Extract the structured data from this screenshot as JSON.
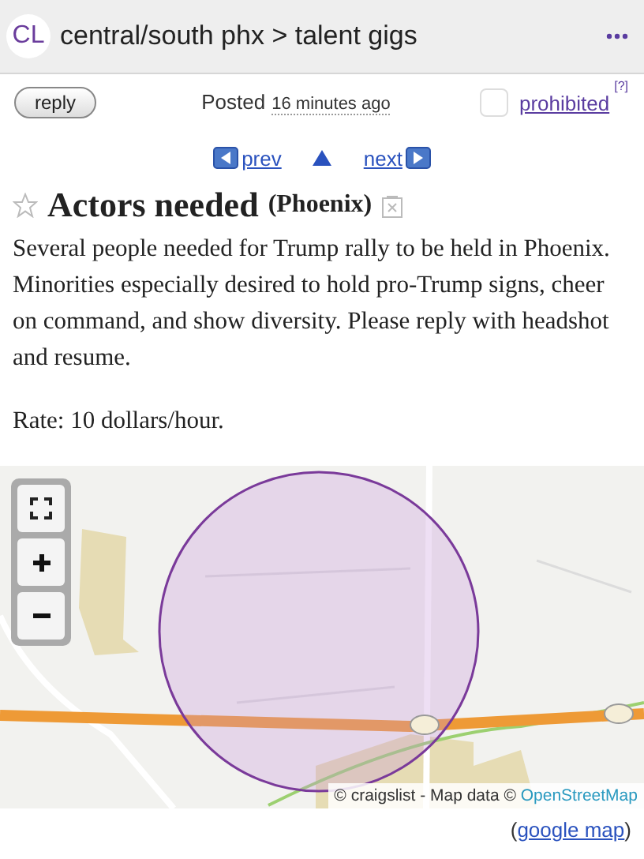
{
  "header": {
    "logo": "CL",
    "breadcrumb": "central/south phx > talent gigs"
  },
  "post_bar": {
    "reply_button": "reply",
    "posted_label": "Posted",
    "posted_time": "16 minutes ago",
    "prohibited": {
      "checked": false,
      "label": "prohibited",
      "help": "[?]"
    }
  },
  "nav": {
    "prev": "prev",
    "next": "next"
  },
  "posting": {
    "title": "Actors needed",
    "location": "(Phoenix)",
    "favorited": false,
    "paragraphs": [
      "Several people needed for Trump rally to be held in Phoenix. Minorities especially desired to hold pro-Trump signs, cheer on command, and show diversity. Please reply with headshot and resume.",
      "Rate: 10 dollars/hour."
    ]
  },
  "map": {
    "attribution": "© craigslist - Map data ©",
    "attribution_link": "OpenStreetMap",
    "open_before": "(",
    "link": "google map",
    "open_after": ")"
  }
}
